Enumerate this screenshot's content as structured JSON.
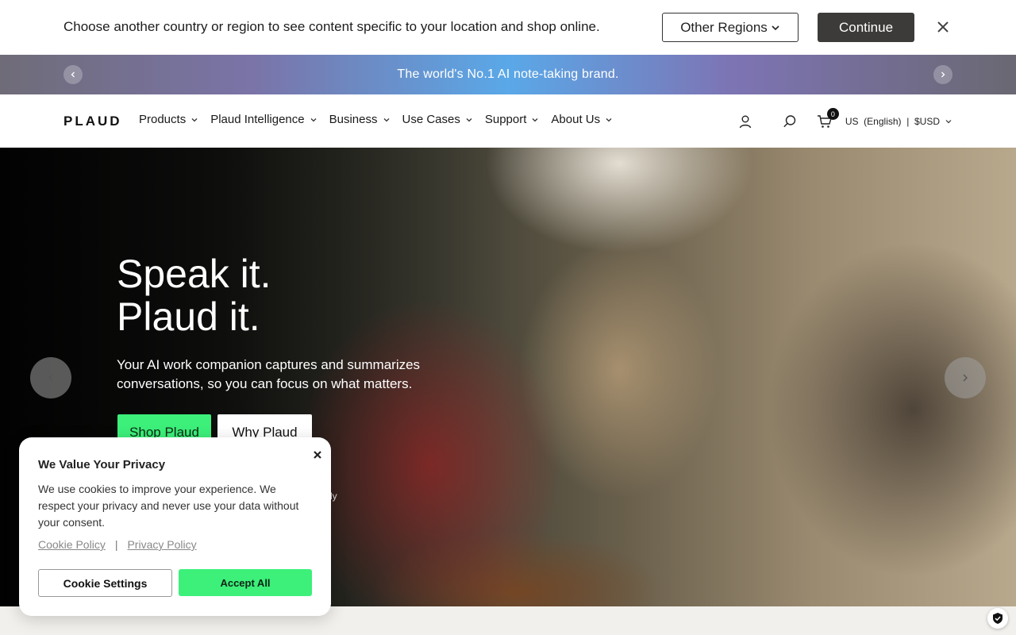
{
  "region_bar": {
    "message": "Choose another country or region to see content specific to your location and shop online.",
    "select_label": "Other Regions",
    "continue_label": "Continue"
  },
  "announcement": {
    "text": "The world's No.1 AI note-taking brand."
  },
  "nav": {
    "logo": "PLAUD",
    "items": [
      {
        "label": "Products"
      },
      {
        "label": "Plaud Intelligence"
      },
      {
        "label": "Business"
      },
      {
        "label": "Use Cases"
      },
      {
        "label": "Support"
      },
      {
        "label": "About Us"
      }
    ],
    "cart_count": "0",
    "locale": "US  (English)  |  $USD"
  },
  "hero": {
    "title_line1": "Speak it.",
    "title_line2": "Plaud it.",
    "subtitle": "Your AI work companion captures and summarizes conversations, so you can focus on what matters.",
    "shop_label": "Shop Plaud",
    "why_label": "Why Plaud",
    "fine_print": "ly"
  },
  "cookie": {
    "title": "We Value Your Privacy",
    "body": "We use cookies to improve your experience. We respect your privacy and never use your data without your consent.",
    "cookie_policy": "Cookie Policy",
    "separator": "|",
    "privacy_policy": "Privacy Policy",
    "settings_label": "Cookie Settings",
    "accept_label": "Accept All"
  },
  "colors": {
    "accent_green": "#3cf07a",
    "dark_button": "#3d3b39"
  }
}
